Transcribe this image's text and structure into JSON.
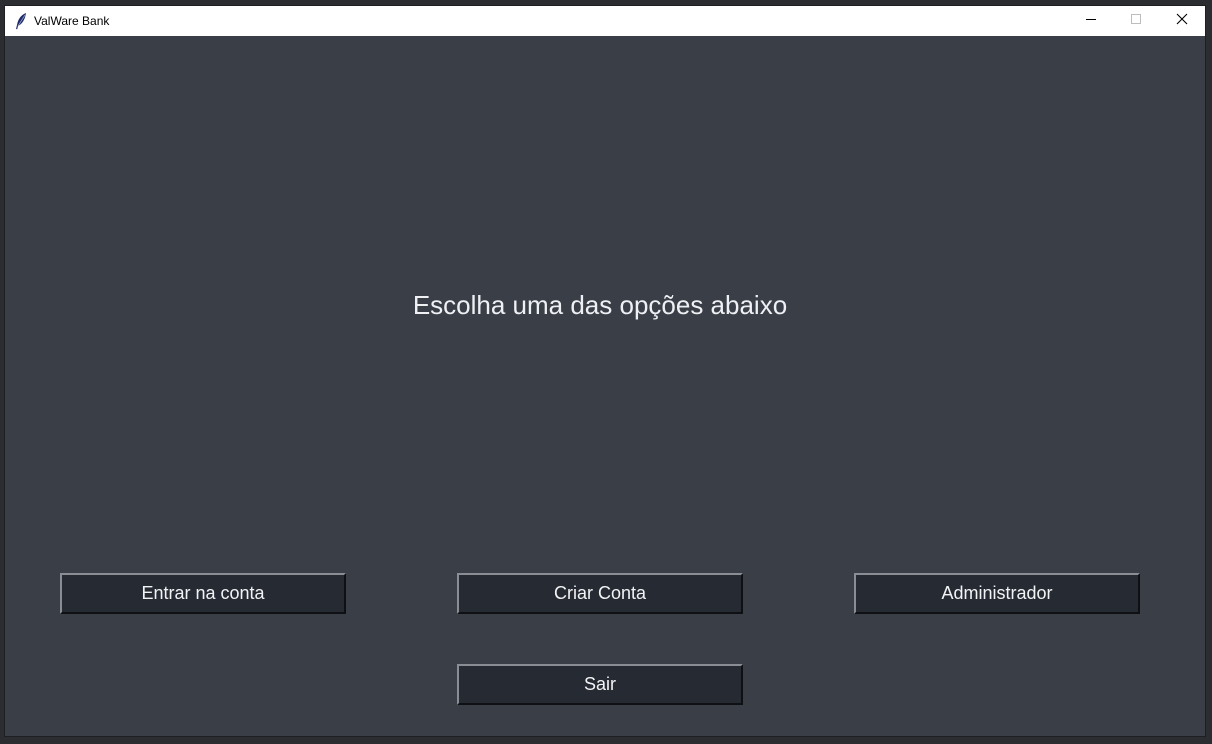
{
  "window": {
    "title": "ValWare Bank",
    "controls": {
      "minimize": "minimize-icon",
      "maximize": "maximize-icon",
      "close": "close-icon"
    }
  },
  "main": {
    "heading": "Escolha uma das opções abaixo",
    "buttons": {
      "login": "Entrar na conta",
      "create": "Criar Conta",
      "admin": "Administrador",
      "exit": "Sair"
    }
  },
  "colors": {
    "background": "#3a3e47",
    "button_bg": "#262a33",
    "text": "#eef0f4",
    "titlebar": "#ffffff"
  }
}
